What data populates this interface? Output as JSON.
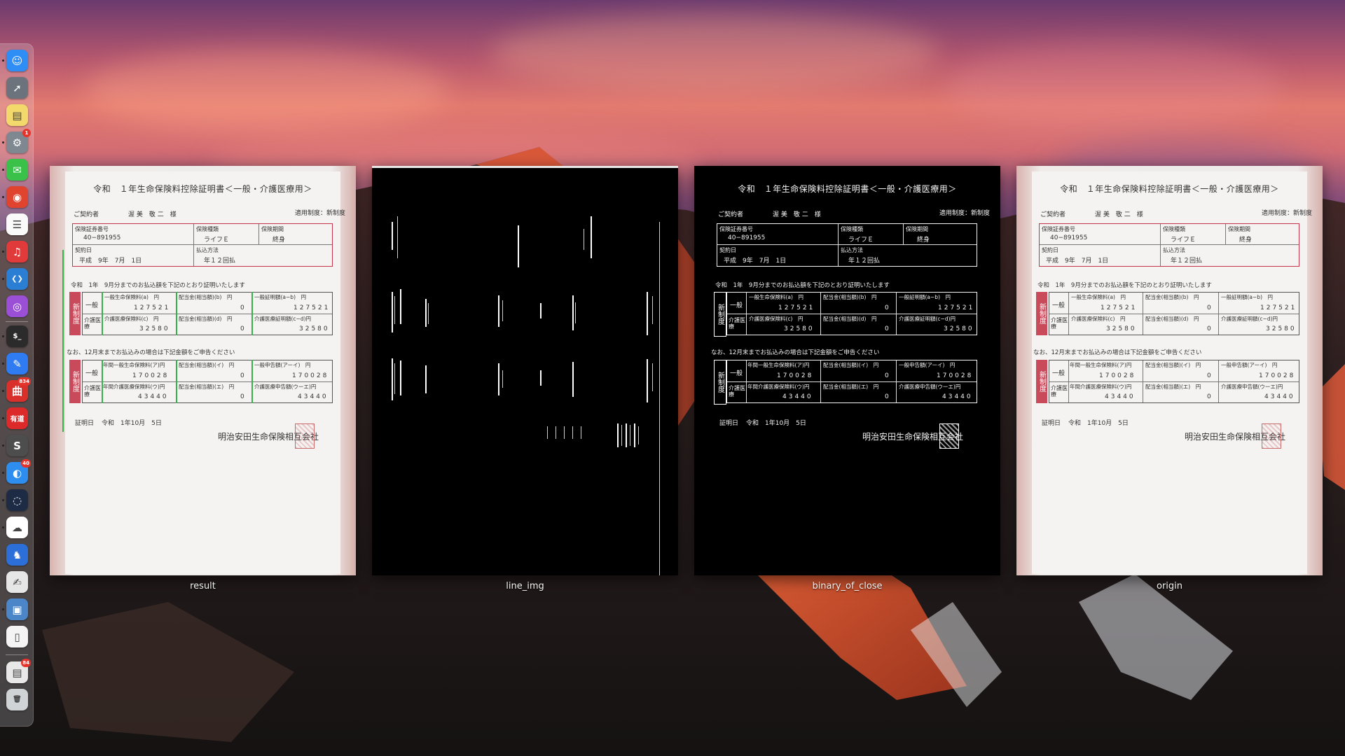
{
  "dock": {
    "items": [
      {
        "name": "finder",
        "icon": "finder-icon",
        "color": "#2f8ef5",
        "glyph": "☺",
        "running": true,
        "badge": ""
      },
      {
        "name": "launchpad",
        "icon": "rocket-icon",
        "color": "#6d737c",
        "glyph": "➚",
        "running": false,
        "badge": ""
      },
      {
        "name": "notes",
        "icon": "notes-icon",
        "color": "#f3d86b",
        "glyph": "▤",
        "running": false,
        "badge": ""
      },
      {
        "name": "system-preferences",
        "icon": "gear-icon",
        "color": "#7f8790",
        "glyph": "⚙",
        "running": true,
        "badge": "1"
      },
      {
        "name": "wechat",
        "icon": "chat-bubbles-icon",
        "color": "#39c14a",
        "glyph": "✉",
        "running": true,
        "badge": ""
      },
      {
        "name": "chrome",
        "icon": "browser-icon",
        "color": "#e0442f",
        "glyph": "◉",
        "running": true,
        "badge": ""
      },
      {
        "name": "reminders",
        "icon": "list-icon",
        "color": "#fafafa",
        "glyph": "☰",
        "running": false,
        "badge": ""
      },
      {
        "name": "netease-music",
        "icon": "music-icon",
        "color": "#e03a3a",
        "glyph": "♫",
        "running": true,
        "badge": ""
      },
      {
        "name": "vscode",
        "icon": "code-icon",
        "color": "#2a7fd4",
        "glyph": "❮❯",
        "running": true,
        "badge": ""
      },
      {
        "name": "podcasts",
        "icon": "podcast-icon",
        "color": "#9a4fd6",
        "glyph": "◎",
        "running": false,
        "badge": ""
      },
      {
        "name": "terminal",
        "icon": "terminal-icon",
        "color": "#2b2b2b",
        "glyph": "$_",
        "running": true,
        "badge": ""
      },
      {
        "name": "lark",
        "icon": "pen-icon",
        "color": "#2f7bf1",
        "glyph": "✎",
        "running": true,
        "badge": ""
      },
      {
        "name": "mail-163",
        "icon": "mail-icon",
        "color": "#d9302b",
        "glyph": "曲",
        "running": true,
        "badge": "834"
      },
      {
        "name": "youdao",
        "icon": "dictionary-icon",
        "color": "#dc2a2a",
        "glyph": "有道",
        "running": true,
        "badge": ""
      },
      {
        "name": "sublime",
        "icon": "editor-icon",
        "color": "#4d4d4d",
        "glyph": "S",
        "running": true,
        "badge": ""
      },
      {
        "name": "qq-browser",
        "icon": "globe-icon",
        "color": "#2d8ef0",
        "glyph": "◐",
        "running": true,
        "badge": "40"
      },
      {
        "name": "app-dark",
        "icon": "circle-icon",
        "color": "#1e2b45",
        "glyph": "◌",
        "running": true,
        "badge": ""
      },
      {
        "name": "baidu-netdisk",
        "icon": "cloud-icon",
        "color": "#ffffff",
        "glyph": "☁",
        "running": true,
        "badge": ""
      },
      {
        "name": "app-horse",
        "icon": "chess-knight-icon",
        "color": "#2c6fd8",
        "glyph": "♞",
        "running": false,
        "badge": ""
      },
      {
        "name": "textedit",
        "icon": "document-pen-icon",
        "color": "#e6e6e6",
        "glyph": "✍",
        "running": false,
        "badge": ""
      },
      {
        "name": "preview",
        "icon": "photos-icon",
        "color": "#4b86c9",
        "glyph": "▣",
        "running": true,
        "badge": ""
      },
      {
        "name": "document",
        "icon": "file-icon",
        "color": "#f4f4f4",
        "glyph": "▯",
        "running": false,
        "badge": ""
      }
    ],
    "extra": [
      {
        "name": "downloads-stack",
        "icon": "stack-icon",
        "color": "#e8e8e8",
        "glyph": "▤",
        "badge": "84"
      },
      {
        "name": "trash",
        "icon": "trash-icon",
        "color": "#cfd3d6",
        "glyph": "🗑",
        "badge": ""
      }
    ]
  },
  "windows": [
    {
      "label": "result"
    },
    {
      "label": "line_img"
    },
    {
      "label": "binary_of_close"
    },
    {
      "label": "origin"
    }
  ],
  "document": {
    "title": "令和　１年生命保険料控除証明書＜一般・介護医療用＞",
    "contractor_label": "ご契約者",
    "contractor_name": "渥 美　敬 二　様",
    "system_label": "適用制度：新制度",
    "policy_no_label": "保険証券番号",
    "policy_no": "40−891955",
    "type_label": "保険種類",
    "type_value": "ライフＥ",
    "period_label": "保険期間",
    "period_value": "終身",
    "contract_date_label": "契約日",
    "contract_date": "平成　9年　7月　1日",
    "payment_label": "払込方法",
    "payment_value": "年１２回払",
    "section1_caption": "令和　1年　9月分までのお払込額を下記のとおり証明いたします",
    "new_system": "新制度",
    "general": "一般",
    "care": "介護医療",
    "h1": "一般生命保険料(a)　円",
    "h2": "配当金(相当額)(b)　円",
    "h3": "一般証明額(a−b)　円",
    "h4": "介護医療保険料(c)　円",
    "h5": "配当金(相当額)(d)　円",
    "h6": "介護医療証明額(c−d)円",
    "v1": "127521",
    "v2": "0",
    "v3": "127521",
    "v4": "32580",
    "v5": "0",
    "v6": "32580",
    "section2_caption": "なお、12月末までお払込みの場合は下記金額をご申告ください",
    "k1": "年間一般生命保険料(ア)円",
    "k2": "配当金(相当額)(イ)　円",
    "k3": "一般申告額(アーイ)　円",
    "k4": "年間介護医療保険料(ウ)円",
    "k5": "配当金(相当額)(エ)　円",
    "k6": "介護医療申告額(ウーエ)円",
    "w1": "170028",
    "w2": "0",
    "w3": "170028",
    "w4": "43440",
    "w5": "0",
    "w6": "43440",
    "issue_label": "証明日",
    "issue_date": "令和　1年10月　5日",
    "company": "明治安田生命保険相互会社"
  }
}
